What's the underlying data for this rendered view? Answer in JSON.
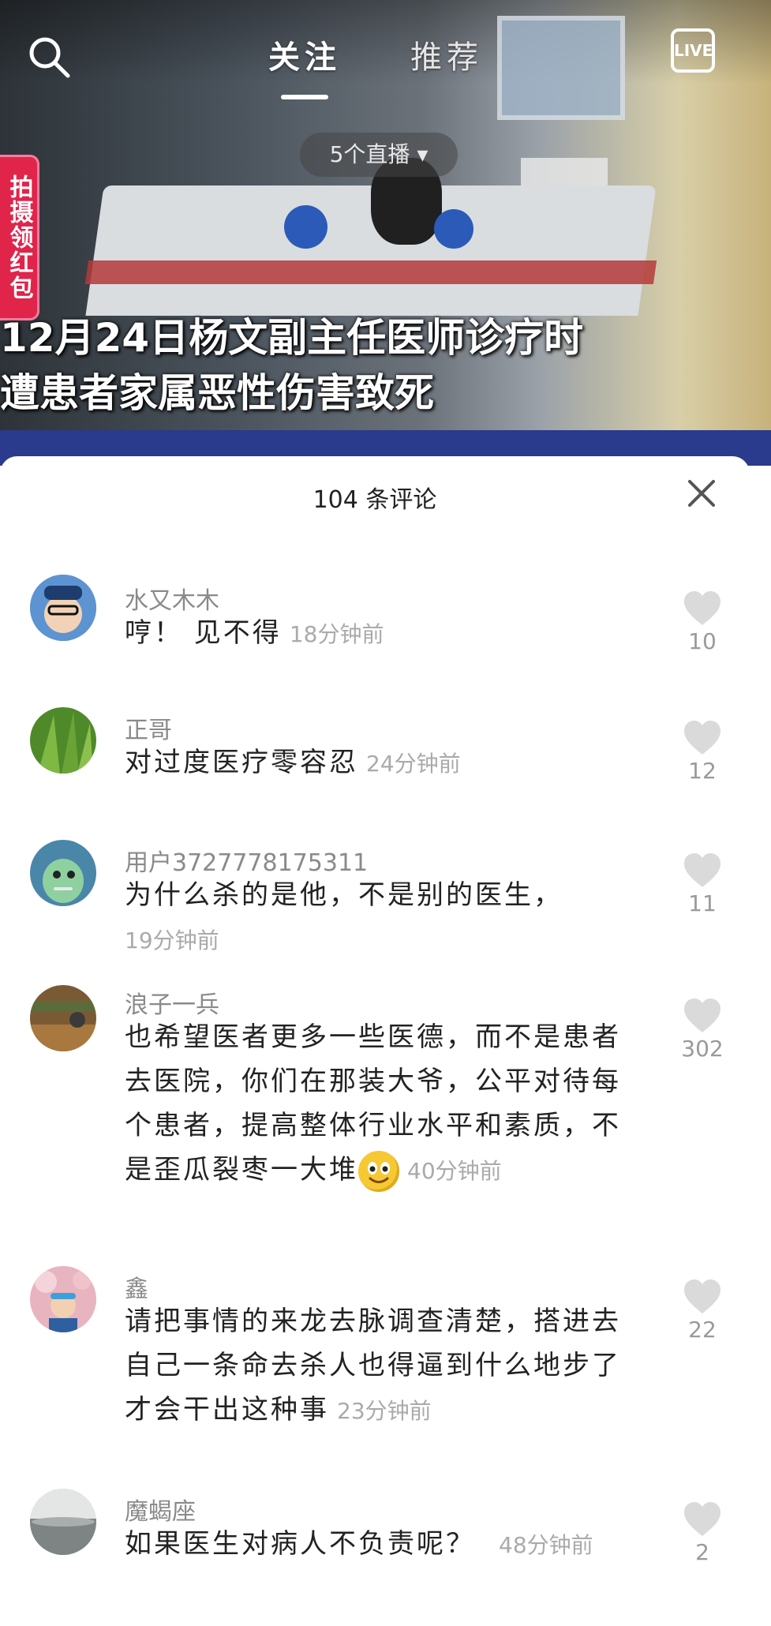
{
  "nav": {
    "tabs": [
      {
        "label": "关注",
        "active": true
      },
      {
        "label": "推荐",
        "active": false
      }
    ],
    "live_label": "LIVE",
    "live_count_pill": "5个直播 ▾"
  },
  "video": {
    "redpack_label": "拍摄领红包",
    "caption_lines": [
      "12月24日杨文副主任医师诊疗时",
      "遭患者家属恶性伤害致死"
    ]
  },
  "sheet": {
    "title": "104 条评论",
    "comments": [
      {
        "user": "水又木木",
        "text": "哼！ 见不得",
        "time": "18分钟前",
        "likes": "10",
        "avatar_color": "#6b9ed6"
      },
      {
        "user": "正哥",
        "text": "对过度医疗零容忍",
        "time": "24分钟前",
        "likes": "12",
        "avatar_color": "#4f8a2a"
      },
      {
        "user": "用户3727778175311",
        "text": "为什么杀的是他，不是别的医生，",
        "time": "19分钟前",
        "likes": "11",
        "avatar_color": "#6aa8a8"
      },
      {
        "user": "浪子一兵",
        "text": "也希望医者更多一些医德，而不是患者去医院，你们在那装大爷，公平对待每个患者，提高整体行业水平和素质，不是歪瓜裂枣一大堆",
        "time": "40分钟前",
        "likes": "302",
        "avatar_color": "#8a6a3e"
      },
      {
        "user": "鑫",
        "text": "请把事情的来龙去脉调查清楚，搭进去自己一条命去杀人也得逼到什么地步了才会干出这种事",
        "time": "23分钟前",
        "likes": "22",
        "avatar_color": "#d89aa8"
      },
      {
        "user": "魔蝎座",
        "text": "如果医生对病人不负责呢？",
        "time": "48分钟前",
        "likes": "2",
        "avatar_color": "#9a9e9e"
      }
    ]
  }
}
